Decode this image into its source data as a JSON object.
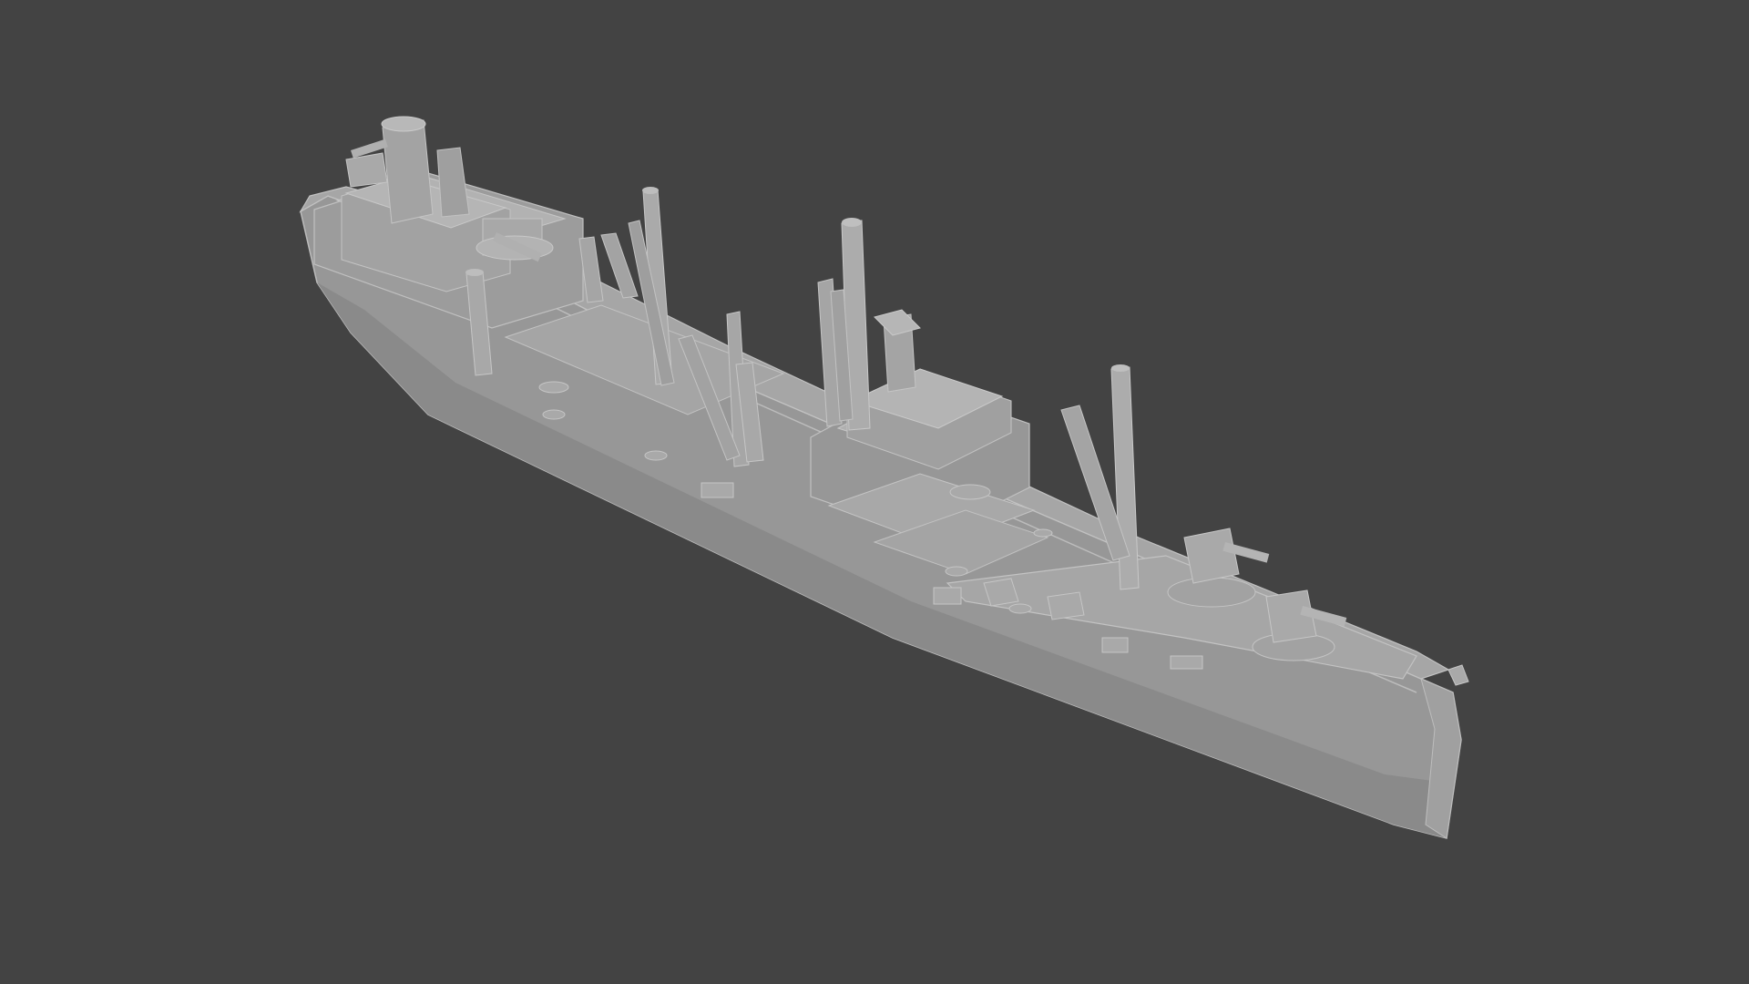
{
  "viewport": {
    "background": "#434343",
    "content": "ship-model"
  },
  "model": {
    "colors": {
      "hull_side": "#9a9a9a",
      "hull_dark": "#858585",
      "deck": "#a4a4a4",
      "superstructure_top": "#b0b0b0",
      "superstructure_side": "#8e8e8e",
      "edge": "#bdbdbd",
      "shadow": "#7a7a7a"
    }
  }
}
